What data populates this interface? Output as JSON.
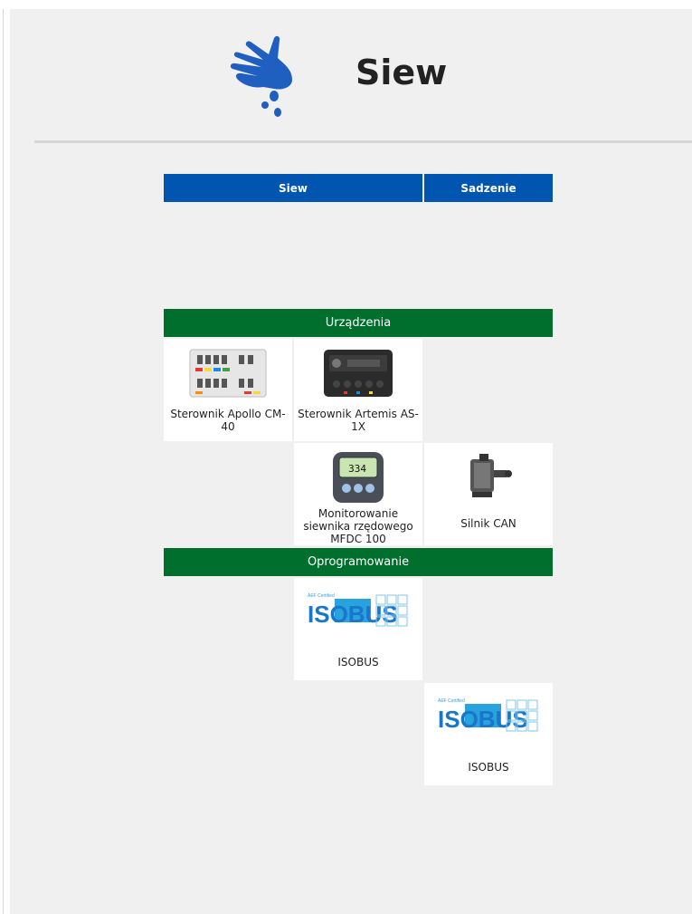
{
  "header": {
    "title": "Siew",
    "logo_icon": "hand-seeds-icon",
    "brand_color": "#1f5fc0"
  },
  "tabs": [
    {
      "label": "Siew"
    },
    {
      "label": "Sadzenie"
    }
  ],
  "sections": {
    "devices": "Urządzenia",
    "software": "Oprogramowanie"
  },
  "devices": [
    {
      "label": "Sterownik Apollo CM-40",
      "icon": "controller-module-icon"
    },
    {
      "label": "Sterownik Artemis AS-1X",
      "icon": "controller-box-icon"
    },
    {
      "label": "Monitorowanie siewnika rzędowego MFDC 100",
      "icon": "monitor-display-icon",
      "display_value": "334"
    },
    {
      "label": "Silnik CAN",
      "icon": "can-motor-icon"
    }
  ],
  "software": [
    {
      "label": "ISOBUS",
      "icon": "isobus-logo-icon",
      "logo_text": "ISOBUS",
      "cert_text": "AEF Certified"
    },
    {
      "label": "ISOBUS",
      "icon": "isobus-logo-icon",
      "logo_text": "ISOBUS",
      "cert_text": "AEF Certified"
    }
  ],
  "colors": {
    "tab": "#0055b0",
    "section": "#006f2e",
    "background": "#f0f0f0"
  }
}
